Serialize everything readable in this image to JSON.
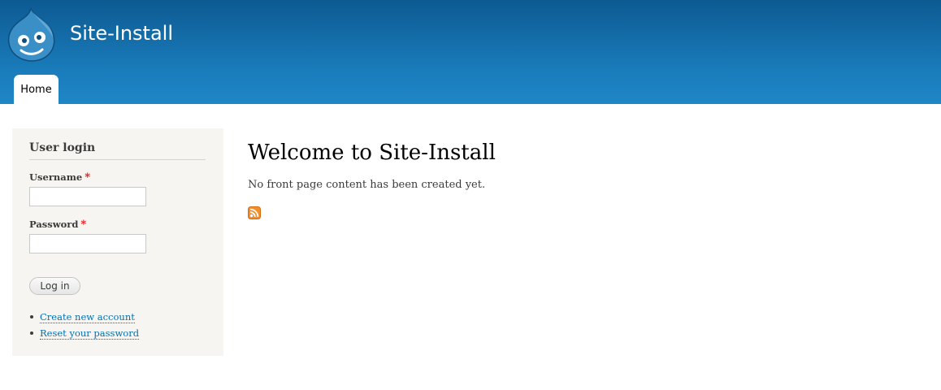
{
  "header": {
    "site_name": "Site-Install",
    "logo_icon": "drupal-logo-icon",
    "nav": [
      {
        "label": "Home",
        "active": true
      }
    ]
  },
  "sidebar": {
    "block_title": "User login",
    "username_label": "Username",
    "password_label": "Password",
    "required_marker": "*",
    "username_value": "",
    "password_value": "",
    "login_button": "Log in",
    "links": [
      "Create new account",
      "Reset your password"
    ]
  },
  "main": {
    "title": "Welcome to Site-Install",
    "text": "No front page content has been created yet.",
    "feed_icon": "rss-feed-icon"
  },
  "colors": {
    "header_top": "#0d5a92",
    "header_bottom": "#1f86c6",
    "link": "#0071b3",
    "sidebar_bg": "#f6f5f1",
    "required": "#e11717",
    "feed": "#f28e2b"
  }
}
